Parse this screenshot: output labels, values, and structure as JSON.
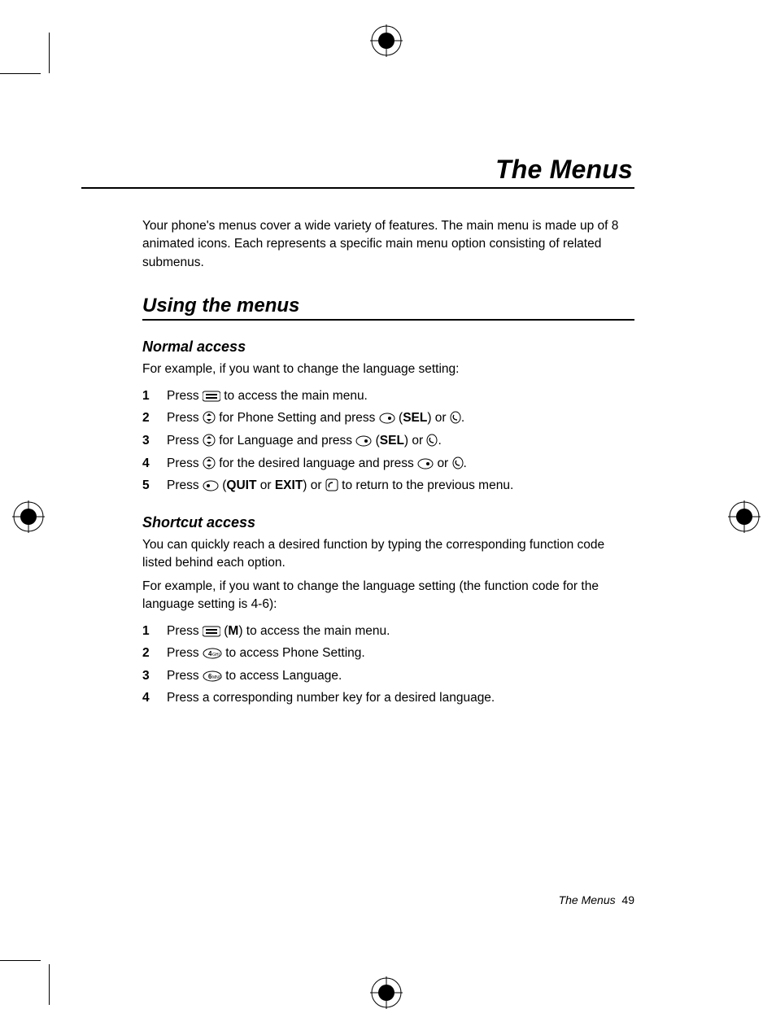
{
  "title": "The Menus",
  "intro": "Your phone's menus cover a wide variety of features. The main menu is made up of 8 animated icons. Each represents a specific main menu option consisting of related submenus.",
  "h2": "Using the menus",
  "normal": {
    "heading": "Normal access",
    "lead": "For example, if you want to change the language setting:",
    "steps": {
      "s1a": "Press ",
      "s1b": " to access the main menu.",
      "s2a": "Press ",
      "s2b": " for Phone Setting and press ",
      "s2sel": "SEL",
      "s2c": ") or ",
      "s2d": ".",
      "s3a": "Press ",
      "s3b": " for Language and press ",
      "s3sel": "SEL",
      "s3c": ") or ",
      "s3d": ".",
      "s4a": "Press ",
      "s4b": " for the desired language and press ",
      "s4c": " or ",
      "s4d": ".",
      "s5a": "Press ",
      "s5quit": "QUIT",
      "s5or": " or ",
      "s5exit": "EXIT",
      "s5b": ") or ",
      "s5c": " to return to the previous menu."
    }
  },
  "shortcut": {
    "heading": "Shortcut access",
    "p1": "You can quickly reach a desired function by typing the corresponding function code listed behind each option.",
    "p2": "For example, if you want to change the language setting (the function code for the language setting is 4-6):",
    "steps": {
      "s1a": "Press ",
      "s1m": "M",
      "s1b": ") to access the main menu.",
      "s2a": "Press ",
      "s2b": " to access Phone Setting.",
      "s3a": "Press ",
      "s3b": " to access Language.",
      "s4": "Press a corresponding number key for a desired language."
    }
  },
  "footer": {
    "label": "The Menus",
    "page": "49"
  },
  "nums": {
    "n1": "1",
    "n2": "2",
    "n3": "3",
    "n4": "4",
    "n5": "5"
  }
}
